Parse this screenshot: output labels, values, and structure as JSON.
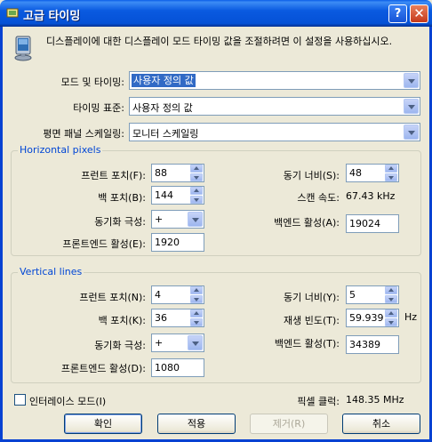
{
  "window": {
    "title": "고급 타이밍",
    "help_button": "?",
    "close_button": "✕"
  },
  "description": "디스플레이에 대한 디스플레이 모드 타이밍 값을 조절하려면 이 설정을 사용하십시오.",
  "mode": {
    "mode_timing_label": "모드 및 타이밍:",
    "mode_timing_value": "사용자 정의 값",
    "timing_standard_label": "타이밍 표준:",
    "timing_standard_value": "사용자 정의 값",
    "scaling_label": "평면 패널 스케일링:",
    "scaling_value": "모니터 스케일링"
  },
  "horizontal": {
    "group_title": "Horizontal pixels",
    "front_porch_label": "프런트 포치(F):",
    "front_porch_value": "88",
    "back_porch_label": "백 포치(B):",
    "back_porch_value": "144",
    "sync_polarity_label": "동기화 극성:",
    "sync_polarity_value": "+",
    "front_active_label": "프론트엔드 활성(E):",
    "front_active_value": "1920",
    "sync_width_label": "동기 너비(S):",
    "sync_width_value": "48",
    "scan_rate_label": "스캔 속도:",
    "scan_rate_value": "67.43 kHz",
    "back_active_label": "백엔드 활성(A):",
    "back_active_value": "19024"
  },
  "vertical": {
    "group_title": "Vertical lines",
    "front_porch_label": "프런트 포치(N):",
    "front_porch_value": "4",
    "back_porch_label": "백 포치(K):",
    "back_porch_value": "36",
    "sync_polarity_label": "동기화 극성:",
    "sync_polarity_value": "+",
    "front_active_label": "프론트엔드 활성(D):",
    "front_active_value": "1080",
    "sync_width_label": "동기 너비(Y):",
    "sync_width_value": "5",
    "refresh_label": "재생 빈도(T):",
    "refresh_value": "59.939",
    "refresh_unit": "Hz",
    "back_active_label": "백엔드 활성(T):",
    "back_active_value": "34389"
  },
  "interlace": {
    "label": "인터레이스 모드(I)",
    "checked": false
  },
  "pixel_clock": {
    "label": "픽셀 클럭:",
    "value": "148.35 MHz"
  },
  "buttons": {
    "ok": "확인",
    "apply": "적용",
    "remove": "제거(R)",
    "cancel": "취소"
  },
  "colors": {
    "title_bar": "#0a5ae0",
    "group_title": "#0046d5",
    "selection": "#316ac5",
    "dialog_bg": "#ece9d8"
  }
}
